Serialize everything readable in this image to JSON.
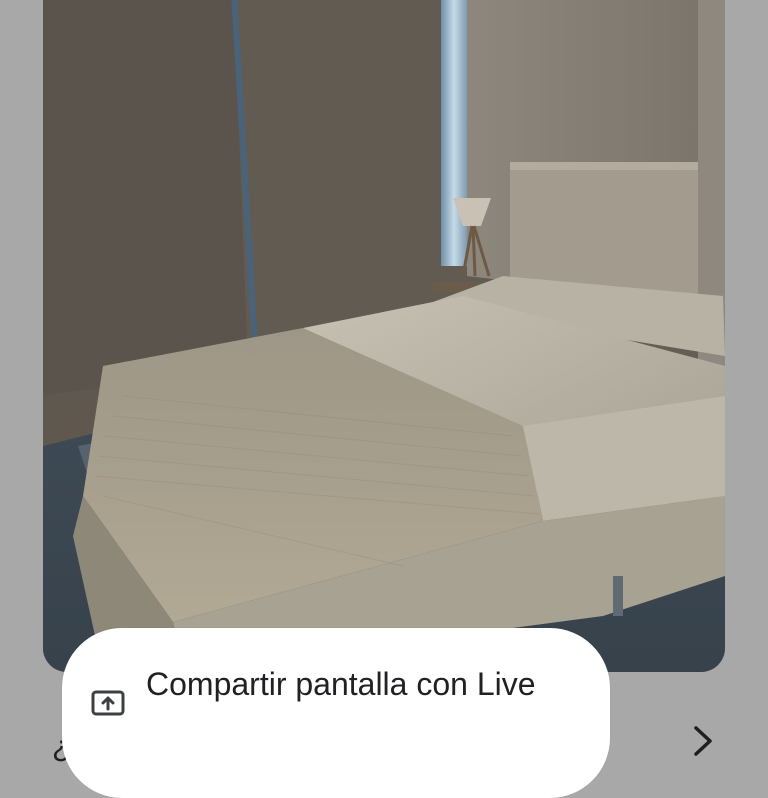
{
  "share_prompt": {
    "label": "Compartir pantalla con Live",
    "icon": "screen-share-icon"
  },
  "bottom_partial_text": "¿C",
  "nav": {
    "next_icon": "chevron-right-icon"
  },
  "colors": {
    "background": "#a8a8a8",
    "chip": "#ffffff",
    "text": "#202124"
  }
}
